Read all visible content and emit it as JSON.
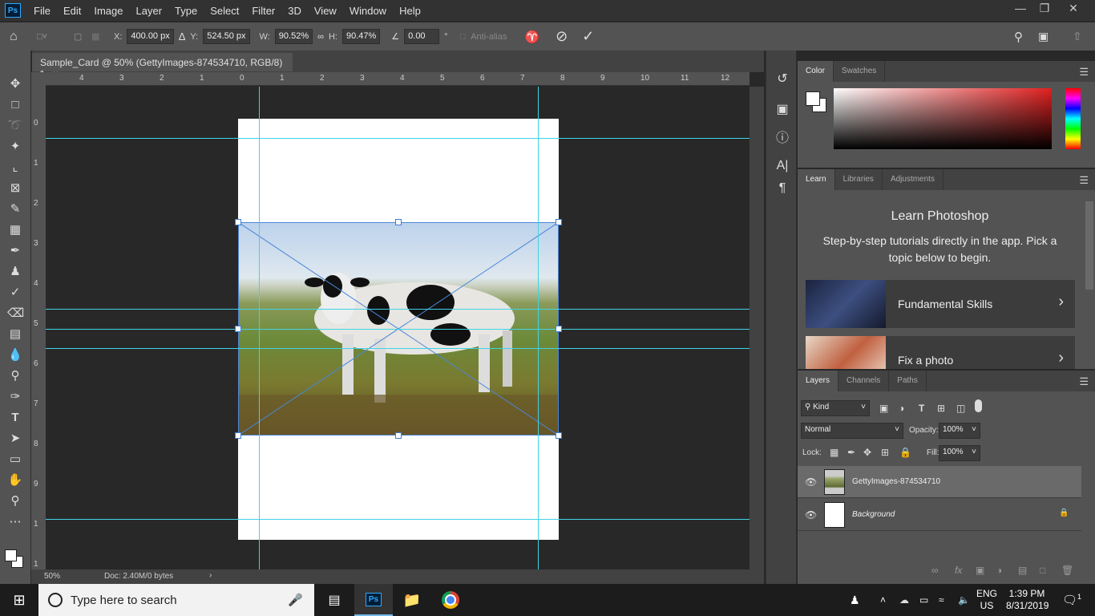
{
  "app": {
    "logo": "Ps",
    "menu": [
      "File",
      "Edit",
      "Image",
      "Layer",
      "Type",
      "Select",
      "Filter",
      "3D",
      "View",
      "Window",
      "Help"
    ],
    "window_controls": [
      "minimize",
      "restore",
      "close"
    ]
  },
  "options": {
    "x_label": "X:",
    "x": "400.00 px",
    "y_label": "Y:",
    "y": "524.50 px",
    "w_label": "W:",
    "w": "90.52%",
    "h_label": "H:",
    "h": "90.47%",
    "angle": "0.00",
    "degree": "°",
    "antialias": "Anti-alias"
  },
  "document": {
    "tab_title": "Sample_Card @ 50% (GettyImages-874534710, RGB/8) *",
    "close": "×",
    "zoom": "50%",
    "doc_info": "Doc: 2.40M/0 bytes",
    "ruler_top": [
      "4",
      "3",
      "2",
      "1",
      "0",
      "1",
      "2",
      "3",
      "4",
      "5",
      "6",
      "7",
      "8",
      "9",
      "10",
      "11",
      "12"
    ],
    "ruler_left": [
      "0",
      "1",
      "2",
      "3",
      "4",
      "5",
      "6",
      "7",
      "8",
      "9",
      "1",
      "1"
    ]
  },
  "color_panel": {
    "tabs": [
      "Color",
      "Swatches"
    ],
    "active": "Color",
    "hue_color": "#e02020"
  },
  "learn_panel": {
    "tabs": [
      "Learn",
      "Libraries",
      "Adjustments"
    ],
    "active": "Learn",
    "title": "Learn Photoshop",
    "subtitle": "Step-by-step tutorials directly in the app. Pick a topic below to begin.",
    "cards": [
      {
        "label": "Fundamental Skills"
      },
      {
        "label": "Fix a photo"
      }
    ]
  },
  "layers_panel": {
    "tabs": [
      "Layers",
      "Channels",
      "Paths"
    ],
    "active": "Layers",
    "filter": "Kind",
    "blend_mode": "Normal",
    "opacity_label": "Opacity:",
    "opacity": "100%",
    "lock_label": "Lock:",
    "fill_label": "Fill:",
    "fill": "100%",
    "layers": [
      {
        "name": "GettyImages-874534710",
        "selected": true
      },
      {
        "name": "Background",
        "locked": true
      }
    ]
  },
  "taskbar": {
    "search_placeholder": "Type here to search",
    "lang": "ENG",
    "region": "US",
    "time": "1:39 PM",
    "date": "8/31/2019",
    "notifications": "1"
  }
}
